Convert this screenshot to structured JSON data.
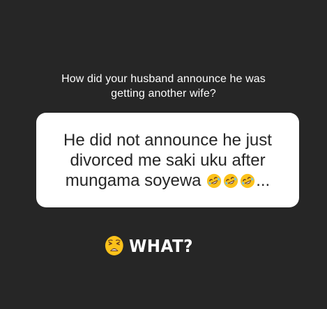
{
  "question": {
    "line1": "How did your husband announce he was",
    "line2": "getting another wife?"
  },
  "answer": {
    "line1": "He did not announce he just",
    "line2": "divorced me saki uku after",
    "line3_text": "mungama soyewa",
    "line3_emoji": [
      "rolling-on-the-floor-laughing-icon",
      "rolling-on-the-floor-laughing-icon",
      "rolling-on-the-floor-laughing-icon"
    ],
    "line3_ellipsis": "..."
  },
  "reply": {
    "emoji": "weary-face-icon",
    "text": "WHAT?"
  },
  "colors": {
    "background": "#262626",
    "card": "#ffffff",
    "text_light": "#ffffff",
    "text_dark": "#262626",
    "emoji_yellow": "#fcc21b"
  }
}
